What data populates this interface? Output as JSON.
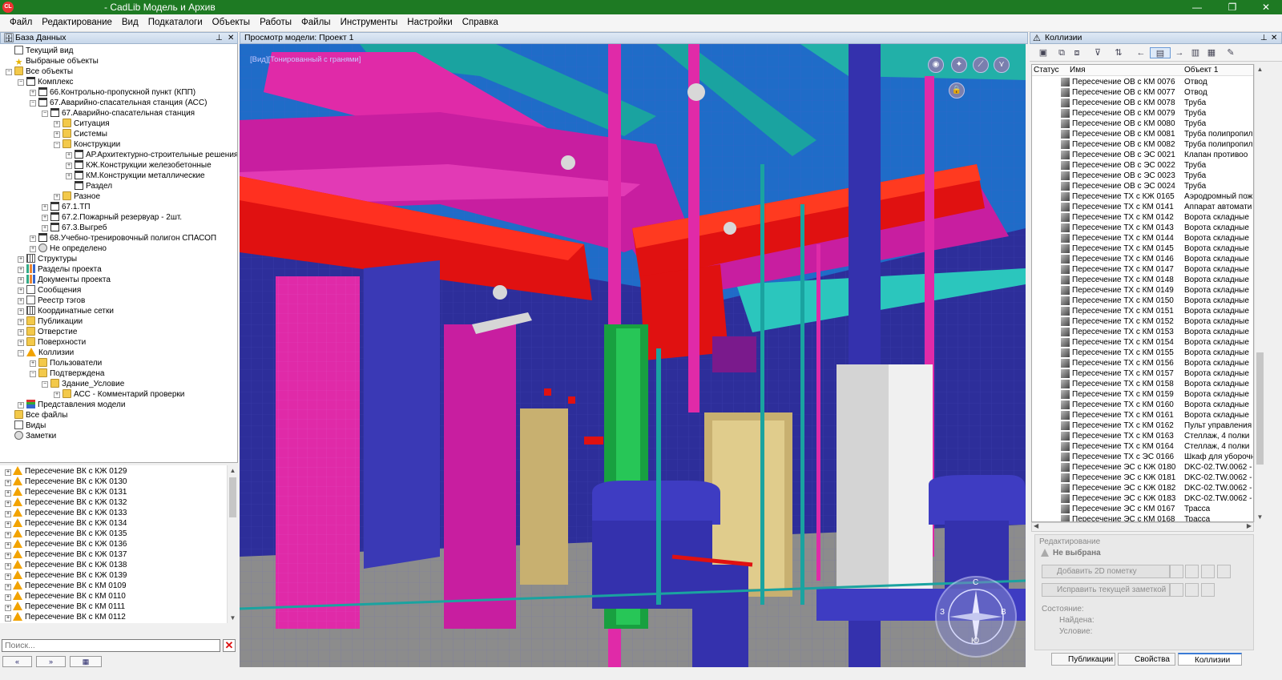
{
  "window": {
    "app_icon": "CL",
    "title": "- CadLib Модель и Архив",
    "btn_min": "—",
    "btn_max": "❐",
    "btn_close": "✕"
  },
  "menu": [
    "Файл",
    "Редактирование",
    "Вид",
    "Подкаталоги",
    "Объекты",
    "Работы",
    "Файлы",
    "Инструменты",
    "Настройки",
    "Справка"
  ],
  "db_panel": {
    "title": "База Данных",
    "pin": "⊥",
    "close": "✕",
    "tree": [
      {
        "label": "Текущий вид",
        "icon": "doc",
        "level": 1,
        "exp": ""
      },
      {
        "label": "Выбраные объекты",
        "icon": "star",
        "level": 1,
        "exp": ""
      },
      {
        "label": "Все объекты",
        "icon": "folder",
        "level": 1,
        "exp": "−"
      },
      {
        "label": "Комплекс",
        "icon": "bld",
        "level": 2,
        "exp": "−"
      },
      {
        "label": "66.Контрольно-пропускной пункт (КПП)",
        "icon": "bld",
        "level": 3,
        "exp": "+"
      },
      {
        "label": "67.Аварийно-спасательная станция (АСС)",
        "icon": "bld",
        "level": 3,
        "exp": "−"
      },
      {
        "label": "67.Аварийно-спасательная станция",
        "icon": "bld",
        "level": 4,
        "exp": "−"
      },
      {
        "label": "Ситуация",
        "icon": "folder",
        "level": 5,
        "exp": "+"
      },
      {
        "label": "Системы",
        "icon": "folder",
        "level": 5,
        "exp": "+"
      },
      {
        "label": "Конструкции",
        "icon": "folder",
        "level": 5,
        "exp": "−"
      },
      {
        "label": "АР.Архитектурно-строительные решения",
        "icon": "bld",
        "level": 6,
        "exp": "+"
      },
      {
        "label": "КЖ.Конструкции железобетонные",
        "icon": "bld",
        "level": 6,
        "exp": "+"
      },
      {
        "label": "КМ.Конструкции металлические",
        "icon": "bld",
        "level": 6,
        "exp": "+"
      },
      {
        "label": "Раздел",
        "icon": "bld",
        "level": 6,
        "exp": ""
      },
      {
        "label": "Разное",
        "icon": "folder",
        "level": 5,
        "exp": "+"
      },
      {
        "label": "67.1.ТП",
        "icon": "bld",
        "level": 4,
        "exp": "+"
      },
      {
        "label": "67.2.Пожарный резервуар - 2шт.",
        "icon": "bld",
        "level": 4,
        "exp": "+"
      },
      {
        "label": "67.3.Выгреб",
        "icon": "bld",
        "level": 4,
        "exp": "+"
      },
      {
        "label": "68.Учебно-тренировочный полигон СПАСОП",
        "icon": "bld",
        "level": 3,
        "exp": "+"
      },
      {
        "label": "Не определено",
        "icon": "globe",
        "level": 3,
        "exp": "+"
      },
      {
        "label": "Структуры",
        "icon": "grid",
        "level": 2,
        "exp": "+"
      },
      {
        "label": "Разделы проекта",
        "icon": "chart",
        "level": 2,
        "exp": "+"
      },
      {
        "label": "Документы проекта",
        "icon": "chart",
        "level": 2,
        "exp": "+"
      },
      {
        "label": "Сообщения",
        "icon": "doc",
        "level": 2,
        "exp": "+"
      },
      {
        "label": "Реестр тэгов",
        "icon": "doc",
        "level": 2,
        "exp": "+"
      },
      {
        "label": "Координатные сетки",
        "icon": "grid",
        "level": 2,
        "exp": "+"
      },
      {
        "label": "Публикации",
        "icon": "folder",
        "level": 2,
        "exp": "+"
      },
      {
        "label": "Отверстие",
        "icon": "folder",
        "level": 2,
        "exp": "+"
      },
      {
        "label": "Поверхности",
        "icon": "folder",
        "level": 2,
        "exp": "+"
      },
      {
        "label": "Коллизии",
        "icon": "warn",
        "level": 2,
        "exp": "−"
      },
      {
        "label": "Пользователи",
        "icon": "folder",
        "level": 3,
        "exp": "+"
      },
      {
        "label": "Подтверждена",
        "icon": "folder",
        "level": 3,
        "exp": "−"
      },
      {
        "label": "Здание_Условие",
        "icon": "folder",
        "level": 4,
        "exp": "−"
      },
      {
        "label": "АСС - Комментарий проверки",
        "icon": "folder",
        "level": 5,
        "exp": "+"
      },
      {
        "label": "Представления модели",
        "icon": "lib",
        "level": 2,
        "exp": "+"
      },
      {
        "label": "Все файлы",
        "icon": "folder",
        "level": 1,
        "exp": ""
      },
      {
        "label": "Виды",
        "icon": "doc",
        "level": 1,
        "exp": ""
      },
      {
        "label": "Заметки",
        "icon": "globe",
        "level": 1,
        "exp": ""
      }
    ]
  },
  "issues_list": [
    "Пересечение ВК с КЖ 0129",
    "Пересечение ВК с КЖ 0130",
    "Пересечение ВК с КЖ 0131",
    "Пересечение ВК с КЖ 0132",
    "Пересечение ВК с КЖ 0133",
    "Пересечение ВК с КЖ 0134",
    "Пересечение ВК с КЖ 0135",
    "Пересечение ВК с КЖ 0136",
    "Пересечение ВК с КЖ 0137",
    "Пересечение ВК с КЖ 0138",
    "Пересечение ВК с КЖ 0139",
    "Пересечение ВК с КМ 0109",
    "Пересечение ВК с КМ 0110",
    "Пересечение ВК с КМ 0111",
    "Пересечение ВК с КМ 0112"
  ],
  "search": {
    "placeholder": "Поиск..."
  },
  "bottom_tabs": [
    "«",
    "»",
    "▦"
  ],
  "viewport": {
    "title": "Просмотр модели: Проект 1",
    "mode": "[Вид][Тонированный с гранями]"
  },
  "collisions_panel": {
    "title": "Коллизии",
    "columns": {
      "status": "Статус",
      "name": "Имя",
      "object": "Объект 1"
    },
    "rows": [
      {
        "status": "warn",
        "name": "Пересечение ОВ с КМ 0076",
        "object": "Отвод"
      },
      {
        "status": "warn",
        "name": "Пересечение ОВ с КМ 0077",
        "object": "Отвод"
      },
      {
        "status": "warn",
        "name": "Пересечение ОВ с КМ 0078",
        "object": "Труба"
      },
      {
        "status": "err",
        "name": "Пересечение ОВ с КМ 0079",
        "object": "Труба"
      },
      {
        "status": "warn",
        "name": "Пересечение ОВ с КМ 0080",
        "object": "Труба"
      },
      {
        "status": "err",
        "name": "Пересечение ОВ с КМ 0081",
        "object": "Труба полипропил"
      },
      {
        "status": "err",
        "name": "Пересечение ОВ с КМ 0082",
        "object": "Труба полипропил"
      },
      {
        "status": "warn",
        "name": "Пересечение ОВ с ЭС 0021",
        "object": "Клапан противоо"
      },
      {
        "status": "err",
        "name": "Пересечение ОВ с ЭС 0022",
        "object": "Труба"
      },
      {
        "status": "err",
        "name": "Пересечение ОВ с ЭС 0023",
        "object": "Труба"
      },
      {
        "status": "err",
        "name": "Пересечение ОВ с ЭС 0024",
        "object": "Труба"
      },
      {
        "status": "warn",
        "name": "Пересечение ТХ с КЖ 0165",
        "object": "Аэродромный пож"
      },
      {
        "status": "warn",
        "name": "Пересечение ТХ с КМ 0141",
        "object": "Аппарат автомати"
      },
      {
        "status": "warn",
        "name": "Пересечение ТХ с КМ 0142",
        "object": "Ворота складные"
      },
      {
        "status": "warn",
        "name": "Пересечение ТХ с КМ 0143",
        "object": "Ворота складные"
      },
      {
        "status": "warn",
        "name": "Пересечение ТХ с КМ 0144",
        "object": "Ворота складные"
      },
      {
        "status": "warn",
        "name": "Пересечение ТХ с КМ 0145",
        "object": "Ворота складные"
      },
      {
        "status": "warn",
        "name": "Пересечение ТХ с КМ 0146",
        "object": "Ворота складные"
      },
      {
        "status": "warn",
        "name": "Пересечение ТХ с КМ 0147",
        "object": "Ворота складные"
      },
      {
        "status": "warn",
        "name": "Пересечение ТХ с КМ 0148",
        "object": "Ворота складные"
      },
      {
        "status": "warn",
        "name": "Пересечение ТХ с КМ 0149",
        "object": "Ворота складные"
      },
      {
        "status": "warn",
        "name": "Пересечение ТХ с КМ 0150",
        "object": "Ворота складные"
      },
      {
        "status": "warn",
        "name": "Пересечение ТХ с КМ 0151",
        "object": "Ворота складные"
      },
      {
        "status": "warn",
        "name": "Пересечение ТХ с КМ 0152",
        "object": "Ворота складные"
      },
      {
        "status": "warn",
        "name": "Пересечение ТХ с КМ 0153",
        "object": "Ворота складные"
      },
      {
        "status": "warn",
        "name": "Пересечение ТХ с КМ 0154",
        "object": "Ворота складные"
      },
      {
        "status": "warn",
        "name": "Пересечение ТХ с КМ 0155",
        "object": "Ворота складные"
      },
      {
        "status": "warn",
        "name": "Пересечение ТХ с КМ 0156",
        "object": "Ворота складные"
      },
      {
        "status": "warn",
        "name": "Пересечение ТХ с КМ 0157",
        "object": "Ворота складные"
      },
      {
        "status": "warn",
        "name": "Пересечение ТХ с КМ 0158",
        "object": "Ворота складные"
      },
      {
        "status": "warn",
        "name": "Пересечение ТХ с КМ 0159",
        "object": "Ворота складные"
      },
      {
        "status": "warn",
        "name": "Пересечение ТХ с КМ 0160",
        "object": "Ворота складные"
      },
      {
        "status": "warn",
        "name": "Пересечение ТХ с КМ 0161",
        "object": "Ворота складные"
      },
      {
        "status": "warn",
        "name": "Пересечение ТХ с КМ 0162",
        "object": "Пульт управления"
      },
      {
        "status": "err",
        "name": "Пересечение ТХ с КМ 0163",
        "object": "Стеллаж, 4 полки"
      },
      {
        "status": "err",
        "name": "Пересечение ТХ с КМ 0164",
        "object": "Стеллаж, 4 полки"
      },
      {
        "status": "warn",
        "name": "Пересечение ТХ с ЭС 0166",
        "object": "Шкаф для уборочн"
      },
      {
        "status": "warn",
        "name": "Пересечение ЭС с КЖ 0180",
        "object": "DKC-02.TW.0062 -"
      },
      {
        "status": "warn",
        "name": "Пересечение ЭС с КЖ 0181",
        "object": "DKC-02.TW.0062 -"
      },
      {
        "status": "warn",
        "name": "Пересечение ЭС с КЖ 0182",
        "object": "DKC-02.TW.0062 -"
      },
      {
        "status": "warn",
        "name": "Пересечение ЭС с КЖ 0183",
        "object": "DKC-02.TW.0062 -"
      },
      {
        "status": "warn",
        "name": "Пересечение ЭС с КМ 0167",
        "object": "Трасса"
      },
      {
        "status": "warn",
        "name": "Пересечение ЭС с КМ 0168",
        "object": "Трасса"
      }
    ]
  },
  "edit_panel": {
    "title": "Редактирование",
    "selection": "Не выбрана",
    "add_2d_mark": "Добавить 2D пометку",
    "fix_note": "Исправить текущей заметкой",
    "state_label": "Состояние:",
    "found_label": "Найдена:",
    "condition_label": "Условие:"
  },
  "right_tabs": [
    "Публикации",
    "Свойства",
    "Коллизии"
  ],
  "compass": {
    "letters": [
      "С",
      "В",
      "Ю",
      "З"
    ]
  }
}
